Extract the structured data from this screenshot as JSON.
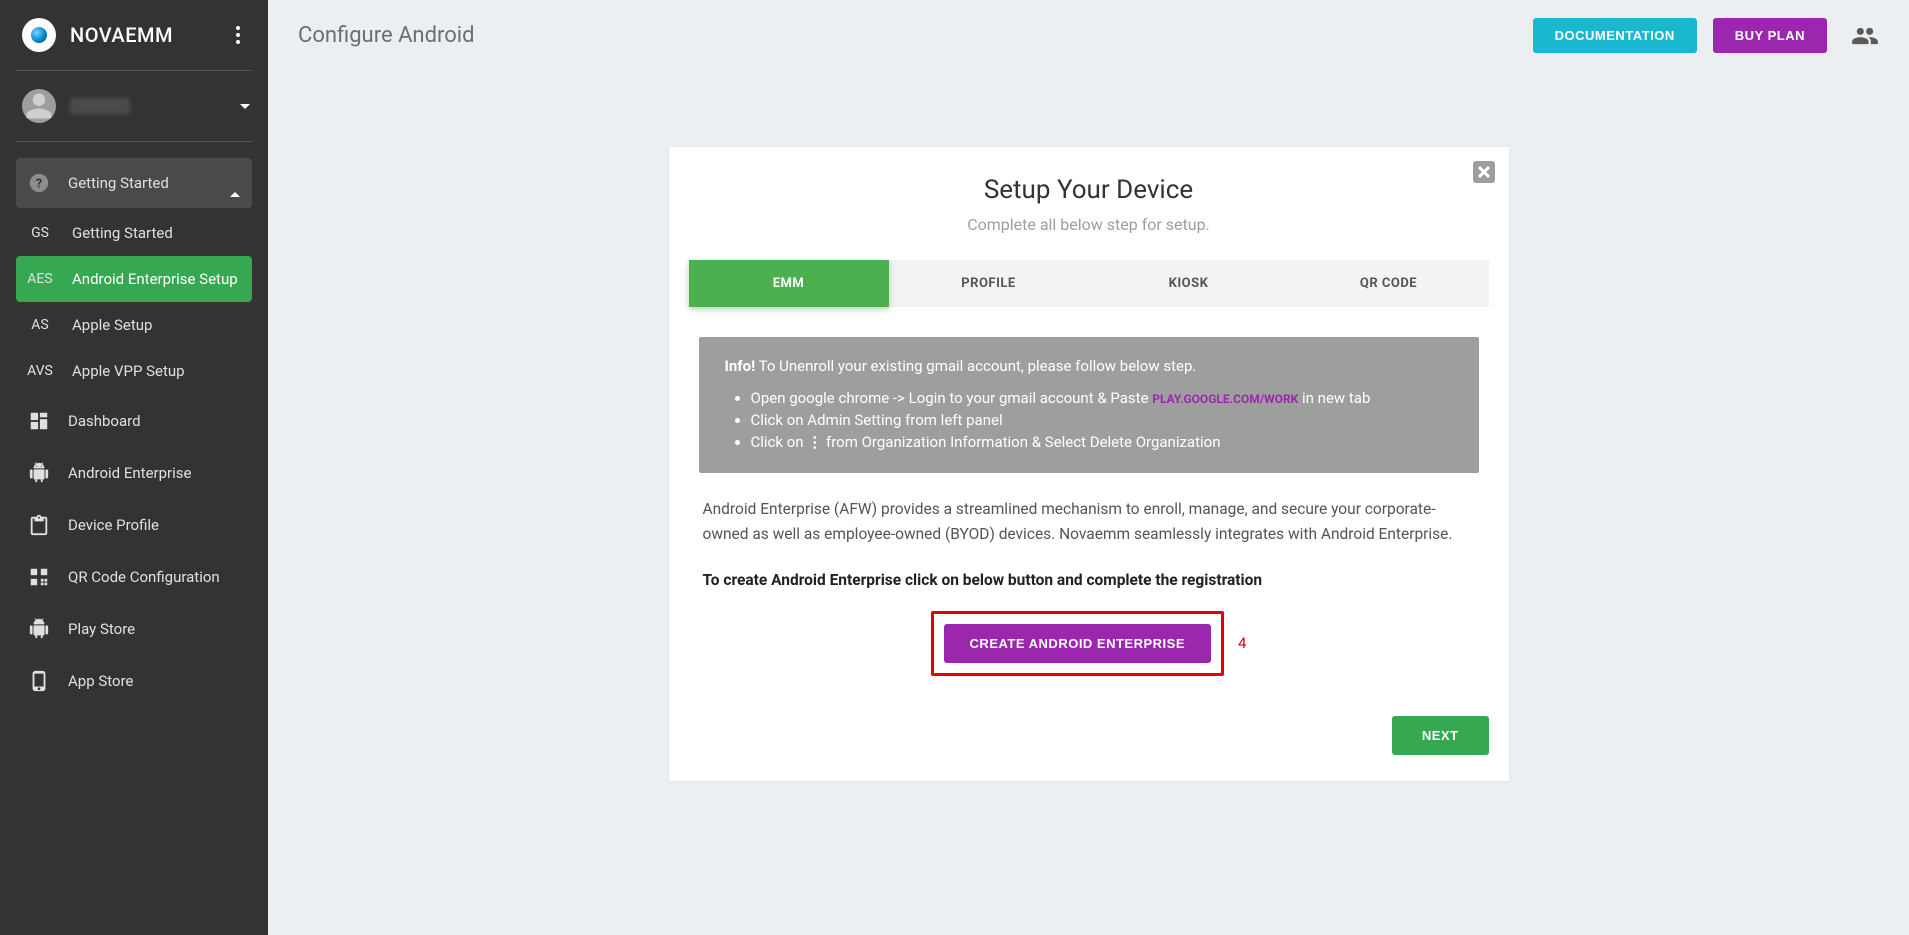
{
  "brand": {
    "name": "NOVAEMM"
  },
  "sidebar": {
    "getting_started": {
      "label": "Getting Started"
    },
    "sub": {
      "gs": {
        "abbr": "GS",
        "label": "Getting Started"
      },
      "aes": {
        "abbr": "AES",
        "label": "Android Enterprise Setup"
      },
      "as": {
        "abbr": "AS",
        "label": "Apple Setup"
      },
      "avs": {
        "abbr": "AVS",
        "label": "Apple VPP Setup"
      }
    },
    "items": {
      "dashboard": "Dashboard",
      "android_ent": "Android Enterprise",
      "device_prof": "Device Profile",
      "qr_config": "QR Code Configuration",
      "play_store": "Play Store",
      "app_store": "App Store"
    }
  },
  "topbar": {
    "title": "Configure Android",
    "doc_btn": "DOCUMENTATION",
    "buy_btn": "BUY PLAN"
  },
  "card": {
    "title": "Setup Your Device",
    "subtitle": "Complete all below step for setup.",
    "tabs": {
      "emm": "EMM",
      "profile": "PROFILE",
      "kiosk": "KIOSK",
      "qr": "QR CODE"
    },
    "info": {
      "prefix": "Info!",
      "lead": " To Unenroll your existing gmail account, please follow below step.",
      "li1_a": "Open google chrome -> Login to your gmail account & Paste ",
      "li1_link": "PLAY.GOOGLE.COM/WORK",
      "li1_b": " in new tab",
      "li2": "Click on Admin Setting from left panel",
      "li3_a": "Click on ",
      "li3_icon": "⋮",
      "li3_b": " from Organization Information & Select Delete Organization"
    },
    "body": "Android Enterprise (AFW) provides a streamlined mechanism to enroll, manage, and secure your corporate-owned as well as employee-owned (BYOD) devices. Novaemm seamlessly integrates with Android Enterprise.",
    "body_strong": "To create Android Enterprise click on below button and complete the registration",
    "create_btn": "CREATE ANDROID ENTERPRISE",
    "annot": "4",
    "next_btn": "NEXT"
  }
}
